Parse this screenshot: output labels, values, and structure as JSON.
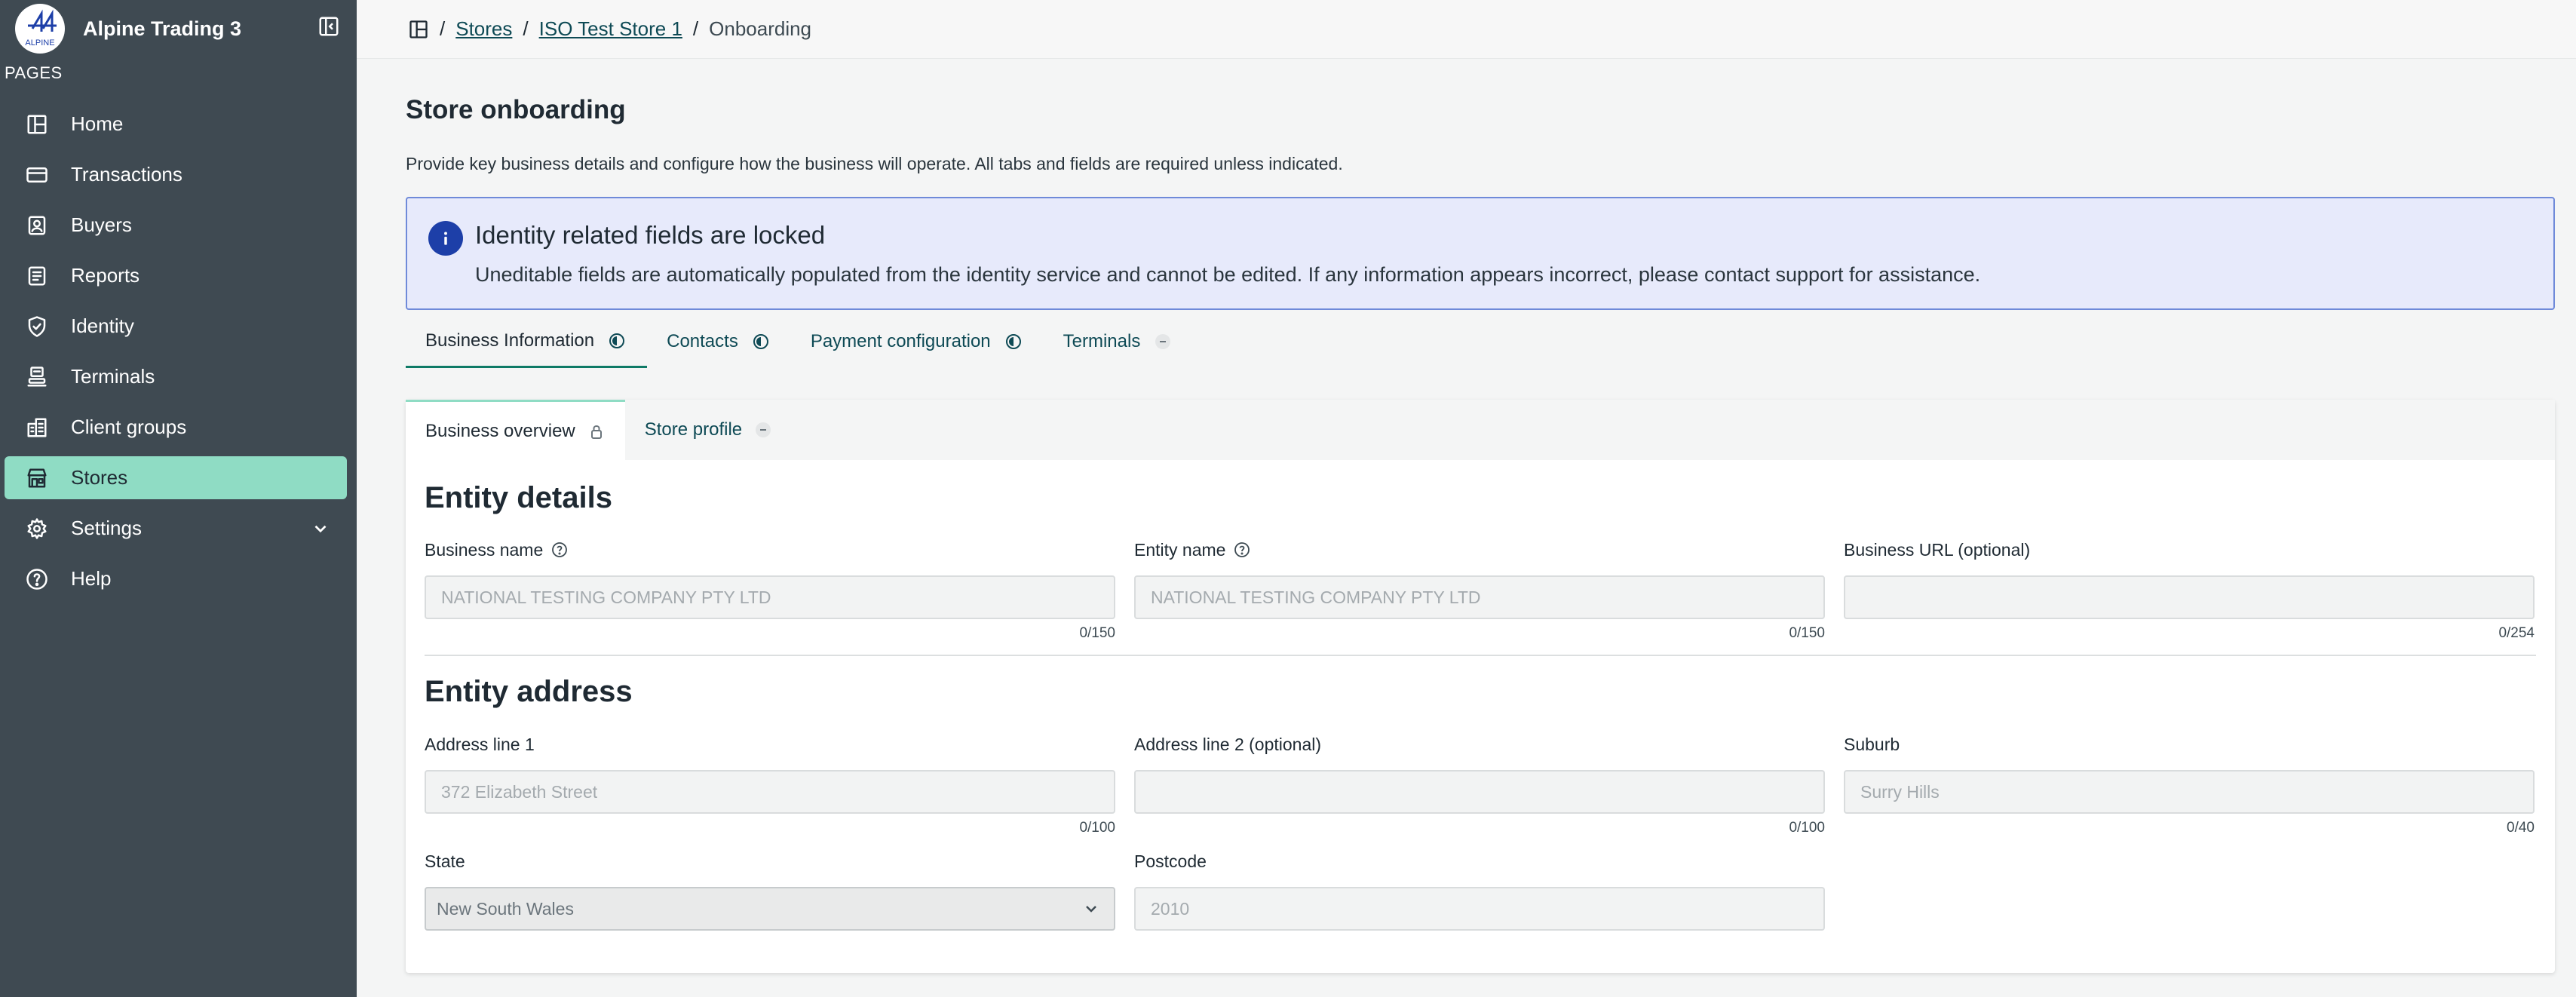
{
  "app": {
    "name": "Alpine Trading 3",
    "logo_text": "ALPINE",
    "pages_label": "PAGES"
  },
  "sidebar": {
    "items": [
      {
        "label": "Home",
        "icon": "home-icon"
      },
      {
        "label": "Transactions",
        "icon": "card-icon"
      },
      {
        "label": "Buyers",
        "icon": "buyers-icon"
      },
      {
        "label": "Reports",
        "icon": "reports-icon"
      },
      {
        "label": "Identity",
        "icon": "shield-icon"
      },
      {
        "label": "Terminals",
        "icon": "terminal-icon"
      },
      {
        "label": "Client groups",
        "icon": "buildings-icon"
      },
      {
        "label": "Stores",
        "icon": "store-icon",
        "active": true
      },
      {
        "label": "Settings",
        "icon": "gear-icon"
      },
      {
        "label": "Help",
        "icon": "help-icon"
      }
    ]
  },
  "breadcrumb": {
    "items": [
      {
        "label": "Stores",
        "link": true
      },
      {
        "label": "ISO Test Store 1",
        "link": true
      },
      {
        "label": "Onboarding",
        "link": false
      }
    ]
  },
  "page": {
    "title": "Store onboarding",
    "description": "Provide key business details and configure how the business will operate. All tabs and fields are required unless indicated."
  },
  "alert": {
    "title": "Identity related fields are locked",
    "body": "Uneditable fields are automatically populated from the identity service and cannot be edited. If any information appears incorrect, please contact support for assistance."
  },
  "tabs": [
    {
      "label": "Business Information",
      "status": "in-progress",
      "active": true
    },
    {
      "label": "Contacts",
      "status": "in-progress"
    },
    {
      "label": "Payment configuration",
      "status": "in-progress"
    },
    {
      "label": "Terminals",
      "status": "not-started"
    }
  ],
  "subtabs": [
    {
      "label": "Business overview",
      "icon": "lock-icon",
      "active": true
    },
    {
      "label": "Store profile",
      "icon": "dash-icon"
    }
  ],
  "entity_details": {
    "title": "Entity details",
    "fields": {
      "business_name": {
        "label": "Business name",
        "value": "NATIONAL TESTING COMPANY PTY LTD",
        "counter": "0/150"
      },
      "entity_name": {
        "label": "Entity name",
        "value": "NATIONAL TESTING COMPANY PTY LTD",
        "counter": "0/150"
      },
      "business_url": {
        "label": "Business URL (optional)",
        "value": "",
        "counter": "0/254"
      }
    }
  },
  "entity_address": {
    "title": "Entity address",
    "fields": {
      "address_line_1": {
        "label": "Address line 1",
        "value": "372 Elizabeth Street",
        "counter": "0/100"
      },
      "address_line_2": {
        "label": "Address line 2 (optional)",
        "value": "",
        "counter": "0/100"
      },
      "suburb": {
        "label": "Suburb",
        "value": "Surry Hills",
        "counter": "0/40"
      },
      "state": {
        "label": "State",
        "value": "New South Wales"
      },
      "postcode": {
        "label": "Postcode",
        "value": "2010"
      }
    }
  },
  "colors": {
    "sidebar_bg": "#3f4a52",
    "active_nav": "#8fdcc4",
    "link": "#0e4a55",
    "alert_bg": "#e7eafb",
    "alert_border": "#6f8ad9",
    "info_icon": "#1d3fa8"
  }
}
